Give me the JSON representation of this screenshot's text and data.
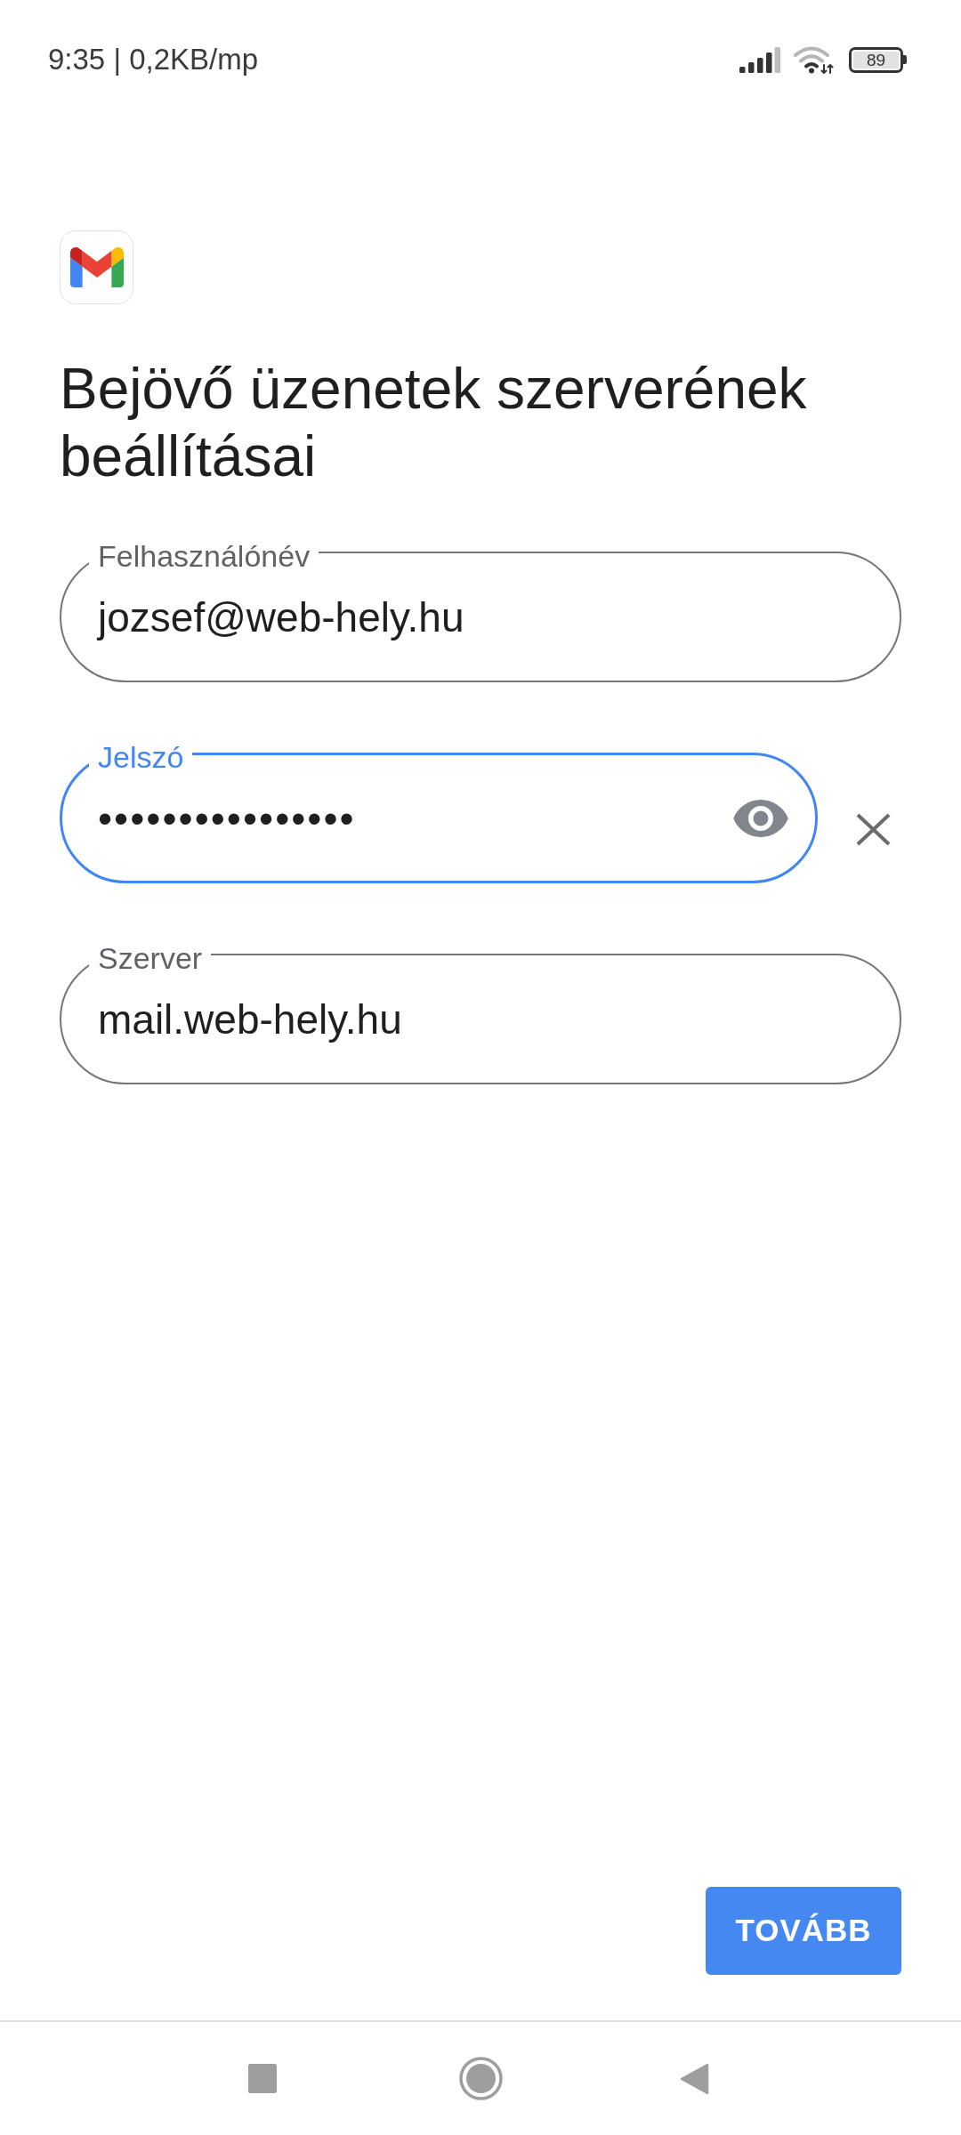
{
  "status_bar": {
    "text": "9:35 | 0,2KB/mp",
    "battery": "89"
  },
  "title": "Bejövő üzenetek szerverének beállításai",
  "fields": [
    {
      "kind": "text",
      "label": "Felhasználónév",
      "value": "jozsef@web-hely.hu",
      "focused": false
    },
    {
      "kind": "password",
      "label": "Jelszó",
      "value": "••••••••••••••••",
      "focused": true
    },
    {
      "kind": "text",
      "label": "Szerver",
      "value": "mail.web-hely.hu",
      "focused": false
    }
  ],
  "next_button": {
    "label": "TOVÁBB"
  }
}
